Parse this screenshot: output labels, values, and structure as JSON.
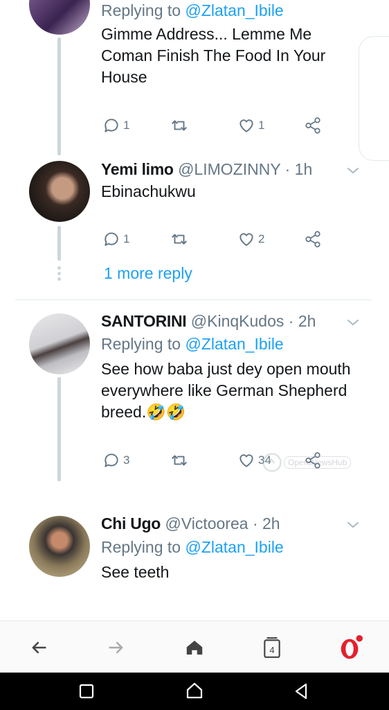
{
  "tweet1": {
    "replying_prefix": "Replying to ",
    "replying_handle": "@Zlatan_Ibile",
    "text": "Gimme Address... Lemme Me Coman Finish The Food In Your House",
    "reply_count": "1",
    "like_count": "1"
  },
  "tweet2": {
    "name": "Yemi limo",
    "meta": "@LIMOZINNY · 1h",
    "text": "Ebinachukwu",
    "reply_count": "1",
    "like_count": "2",
    "more_reply": "1 more reply"
  },
  "tweet3": {
    "name": "SANTORINI",
    "meta": "@KinqKudos · 2h",
    "replying_prefix": "Replying to ",
    "replying_handle": "@Zlatan_Ibile",
    "text": "See how baba just dey open mouth everywhere like German Shepherd breed.",
    "emoji": "🤣🤣",
    "reply_count": "3",
    "like_count": "34"
  },
  "tweet4": {
    "name": "Chi Ugo",
    "meta": "@Victoorea · 2h",
    "replying_prefix": "Replying to ",
    "replying_handle": "@Zlatan_Ibile",
    "text": "See teeth"
  },
  "watermark": "OperaNewsHub",
  "browser_bar": {
    "tab_count": "4"
  },
  "colors": {
    "link": "#1da1f2",
    "muted": "#657786",
    "opera_red": "#e4202e"
  }
}
